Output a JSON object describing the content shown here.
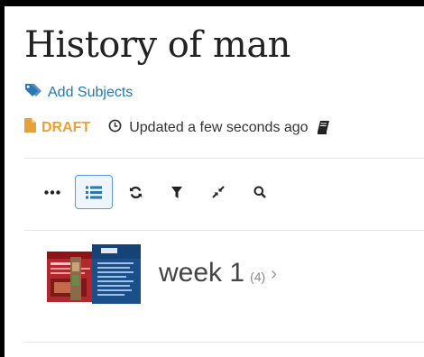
{
  "page": {
    "title": "History of man"
  },
  "subjects": {
    "add_label": "Add Subjects",
    "icon": "tags-icon"
  },
  "status": {
    "draft_label": "DRAFT",
    "draft_icon": "file-icon",
    "draft_color": "#e6a13a",
    "updated_text": "Updated a few seconds ago",
    "updated_icon": "clock-icon",
    "extra_icon": "book-icon"
  },
  "toolbar": {
    "buttons": [
      {
        "name": "more",
        "icon": "ellipsis-icon",
        "active": false
      },
      {
        "name": "list-view",
        "icon": "list-icon",
        "active": true
      },
      {
        "name": "refresh",
        "icon": "refresh-icon",
        "active": false
      },
      {
        "name": "filter",
        "icon": "filter-icon",
        "active": false
      },
      {
        "name": "collapse",
        "icon": "compress-icon",
        "active": false
      },
      {
        "name": "search",
        "icon": "search-icon",
        "active": false
      }
    ]
  },
  "sections": [
    {
      "title": "week 1",
      "count": "(4)",
      "chevron": "›"
    }
  ],
  "colors": {
    "link": "#2577b5",
    "active_border": "#5b9bd5"
  }
}
